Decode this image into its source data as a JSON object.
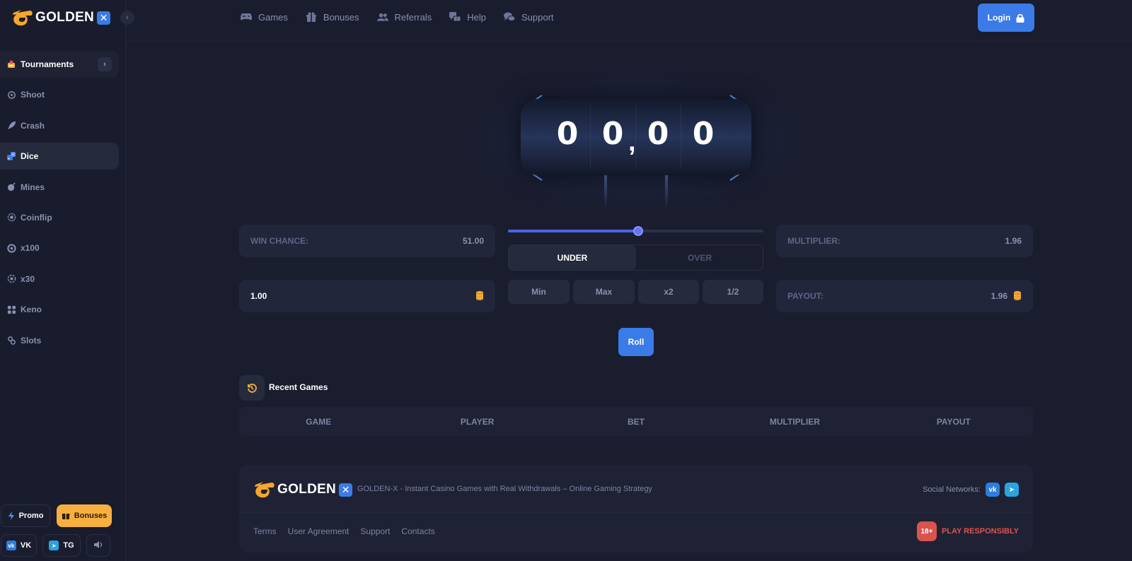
{
  "brand": {
    "name": "GOLDEN",
    "badge": "✕"
  },
  "header": {
    "nav": [
      {
        "label": "Games",
        "icon": "gamepad-icon"
      },
      {
        "label": "Bonuses",
        "icon": "gift-icon"
      },
      {
        "label": "Referrals",
        "icon": "users-icon"
      },
      {
        "label": "Help",
        "icon": "help-chat-icon"
      },
      {
        "label": "Support",
        "icon": "support-chat-icon"
      }
    ],
    "login_label": "Login"
  },
  "sidebar": {
    "items": [
      {
        "label": "Tournaments",
        "icon": "trophy-icon"
      },
      {
        "label": "Shoot",
        "icon": "target-icon"
      },
      {
        "label": "Crash",
        "icon": "rocket-icon"
      },
      {
        "label": "Dice",
        "icon": "dice-icon"
      },
      {
        "label": "Mines",
        "icon": "bomb-icon"
      },
      {
        "label": "Coinflip",
        "icon": "coin-icon"
      },
      {
        "label": "x100",
        "icon": "wheel-icon"
      },
      {
        "label": "x30",
        "icon": "wheel-icon"
      },
      {
        "label": "Keno",
        "icon": "grid-icon"
      },
      {
        "label": "Slots",
        "icon": "slots-icon"
      }
    ],
    "active": "Dice",
    "promo_label": "Promo",
    "bonuses_label": "Bonuses",
    "vk_label": "VK",
    "tg_label": "TG"
  },
  "game": {
    "digits": [
      "0",
      "0",
      "0",
      "0"
    ],
    "comma": ",",
    "win_chance_label": "WIN CHANCE:",
    "win_chance_value": "51.00",
    "bet_value": "1.00",
    "slider_fraction": 0.51,
    "under_label": "UNDER",
    "over_label": "OVER",
    "quick_buttons": [
      "Min",
      "Max",
      "x2",
      "1/2"
    ],
    "multiplier_label": "MULTIPLIER:",
    "multiplier_value": "1.96",
    "payout_label": "PAYOUT:",
    "payout_value": "1.96",
    "roll_label": "Roll"
  },
  "recent": {
    "title": "Recent Games",
    "columns": [
      "GAME",
      "PLAYER",
      "BET",
      "MULTIPLIER",
      "PAYOUT"
    ]
  },
  "footer": {
    "brand": "GOLDEN",
    "description": "GOLDEN-X - Instant Casino Games with Real Withdrawals – Online Gaming Strategy",
    "social_label": "Social Networks:",
    "links": [
      "Terms",
      "User Agreement",
      "Support",
      "Contacts"
    ],
    "age_badge": "18+",
    "responsible": "PLAY RESPONSIBLY"
  },
  "colors": {
    "accent": "#3b7be8",
    "gold": "#f7b040",
    "background": "#1a1d2e",
    "warning": "#e0524e"
  }
}
